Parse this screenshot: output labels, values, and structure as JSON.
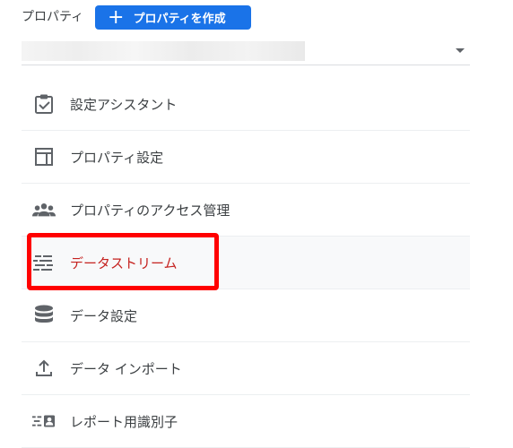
{
  "header": {
    "label": "プロパティ",
    "create_button": "プロパティを作成",
    "create_button_icon": "plus-icon"
  },
  "property_selector": {
    "value": "",
    "icon": "dropdown-arrow-icon"
  },
  "menu": {
    "items": [
      {
        "label": "設定アシスタント",
        "icon": "clipboard-check-icon"
      },
      {
        "label": "プロパティ設定",
        "icon": "property-layout-icon"
      },
      {
        "label": "プロパティのアクセス管理",
        "icon": "people-icon"
      },
      {
        "label": "データストリーム",
        "icon": "data-streams-icon",
        "active": true
      },
      {
        "label": "データ設定",
        "icon": "database-icon"
      },
      {
        "label": "データ インポート",
        "icon": "upload-icon"
      },
      {
        "label": "レポート用識別子",
        "icon": "identity-card-icon"
      }
    ]
  },
  "colors": {
    "primary": "#1a73e8",
    "active_text": "#c5221f",
    "highlight_border": "#ff0000",
    "icon": "#5f6368"
  }
}
